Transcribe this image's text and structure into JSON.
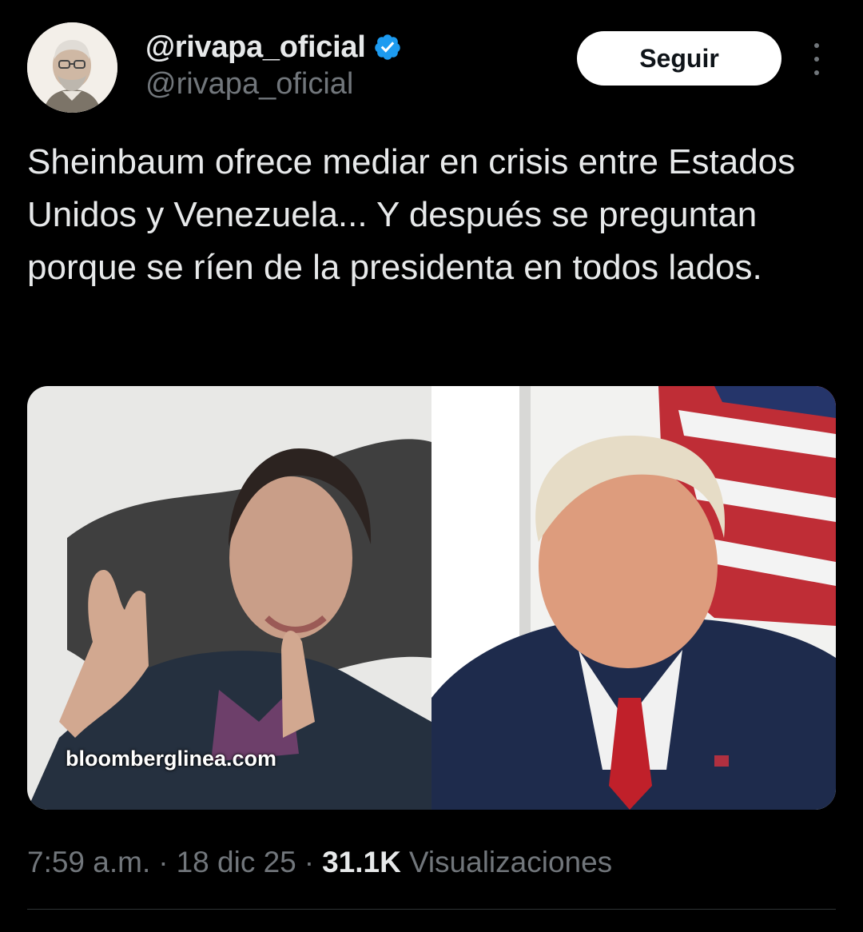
{
  "author": {
    "display_name": "@rivapa_oficial",
    "handle": "@rivapa_oficial",
    "verified": true,
    "verified_icon": "verified-badge-icon",
    "verified_color": "#1d9bf0"
  },
  "actions": {
    "follow_label": "Seguir",
    "more_icon": "more-vertical-icon"
  },
  "tweet": {
    "text": "Sheinbaum ofrece mediar en crisis entre Estados Unidos y Venezuela... Y después se preguntan porque se ríen de la presidenta en todos lados.",
    "media_watermark": "bloomberglinea.com"
  },
  "meta": {
    "time": "7:59 a.m.",
    "separator": "·",
    "date": "18 dic 25",
    "views_count": "31.1K",
    "views_label": "Visualizaciones"
  },
  "colors": {
    "background": "#000000",
    "text_primary": "#e7e9ea",
    "text_secondary": "#71767b",
    "divider": "#2f3336"
  }
}
